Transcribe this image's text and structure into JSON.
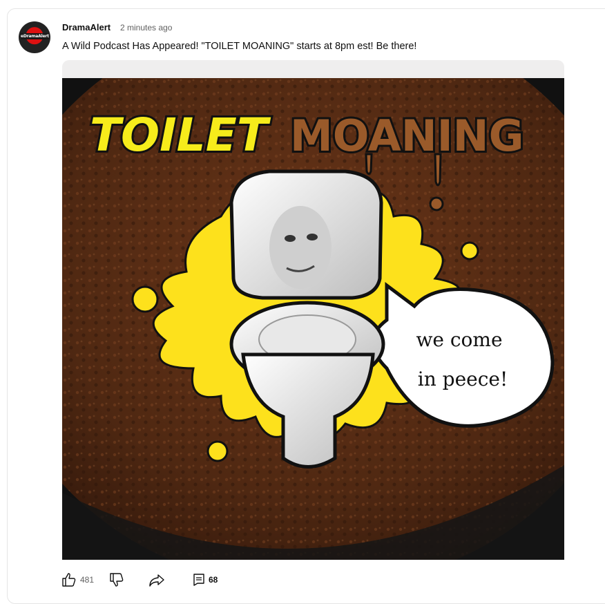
{
  "post": {
    "channel_name": "DramaAlert",
    "avatar_text": "eDramaAlert",
    "timestamp": "2 minutes ago",
    "text": "A Wild Podcast Has Appeared! \"TOILET MOANING\" starts at 8pm est! Be there!"
  },
  "image": {
    "title_left": "TOILET",
    "title_right": "MOANING",
    "bubble_line1": "we come",
    "bubble_line2": "in peece!"
  },
  "actions": {
    "likes": "481",
    "comments": "68",
    "like_icon": "thumbs-up-icon",
    "dislike_icon": "thumbs-down-icon",
    "share_icon": "share-icon",
    "comment_icon": "comment-icon"
  },
  "colors": {
    "title_yellow": "#f6ec1b",
    "title_brown": "#9a5a2a",
    "splash_yellow": "#fde11c",
    "background_brown": "#4a2410"
  }
}
